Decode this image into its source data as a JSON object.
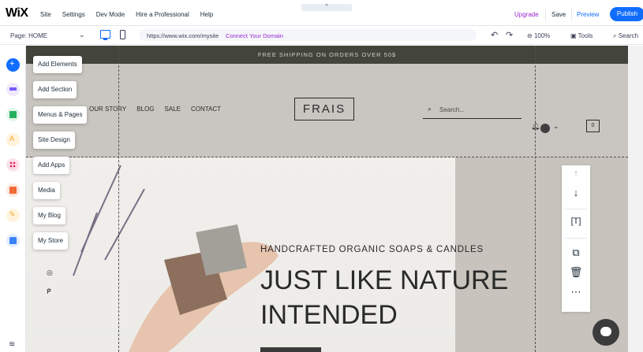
{
  "topbar": {
    "logo": "WiX",
    "menu": [
      "Site",
      "Settings",
      "Dev Mode",
      "Hire a Professional",
      "Help"
    ],
    "collapse_handle": "^",
    "upgrade": "Upgrade",
    "save": "Save",
    "preview": "Preview",
    "publish": "Publish"
  },
  "subbar": {
    "page_select": "Page: HOME",
    "url": "https://www.wix.com/mysite",
    "connect_domain": "Connect Your Domain",
    "zoom": "100%",
    "tools": "Tools",
    "search": "Search"
  },
  "sidebar": {
    "items": [
      {
        "label": "Add Elements",
        "icon": "plus-icon",
        "color": "#116dff"
      },
      {
        "label": "Add Section",
        "icon": "section-icon",
        "color": "#7a5af8"
      },
      {
        "label": "Menus & Pages",
        "icon": "pages-icon",
        "color": "#25b05f"
      },
      {
        "label": "Site Design",
        "icon": "design-icon",
        "color": "#f5a623"
      },
      {
        "label": "Add Apps",
        "icon": "apps-icon",
        "color": "#e8245b"
      },
      {
        "label": "Media",
        "icon": "media-icon",
        "color": "#f26a36"
      },
      {
        "label": "My Blog",
        "icon": "blog-icon",
        "color": "#f5a623"
      },
      {
        "label": "My Store",
        "icon": "store-icon",
        "color": "#3b82f6"
      }
    ]
  },
  "site": {
    "announcement": "FREE SHIPPING ON ORDERS OVER 50$",
    "nav": [
      "OUR STORY",
      "BLOG",
      "SALE",
      "CONTACT"
    ],
    "logo": "FRAIS",
    "search_placeholder": "Search...",
    "cart_count": "0",
    "hero_subtitle": "HANDCRAFTED ORGANIC SOAPS & CANDLES",
    "hero_title_line1": "JUST LIKE NATURE",
    "hero_title_line2": "INTENDED"
  },
  "colors": {
    "accent": "#116dff",
    "upgrade": "#9a27d5",
    "announcement_bg": "#43453c"
  }
}
